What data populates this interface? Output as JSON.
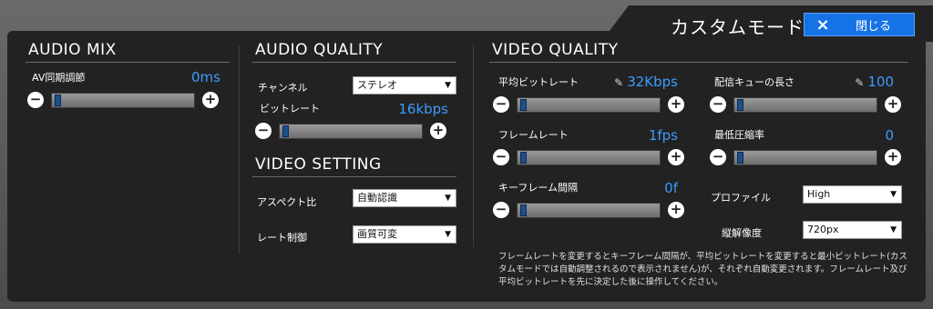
{
  "header": {
    "title": "カスタムモード",
    "close_label": "閉じる",
    "close_icon": "×"
  },
  "audio_mix": {
    "title": "AUDIO MIX",
    "av_sync": {
      "label": "AV同期調節",
      "value": "0ms",
      "level": 0.02
    }
  },
  "audio_quality": {
    "title": "AUDIO QUALITY",
    "channel": {
      "label": "チャンネル",
      "selected": "ステレオ"
    },
    "bitrate": {
      "label": "ビットレート",
      "value": "16kbps",
      "level": 0.02
    }
  },
  "video_setting": {
    "title": "VIDEO SETTING",
    "aspect": {
      "label": "アスペクト比",
      "selected": "自動認識"
    },
    "rate_control": {
      "label": "レート制御",
      "selected": "画質可変"
    }
  },
  "video_quality": {
    "title": "VIDEO QUALITY",
    "avg_bitrate": {
      "label": "平均ビットレート",
      "value": "32Kbps",
      "level": 0.02
    },
    "frame_rate": {
      "label": "フレームレート",
      "value": "1fps",
      "level": 0.02
    },
    "keyframe_interval": {
      "label": "キーフレーム間隔",
      "value": "0f",
      "level": 0.02
    },
    "queue_length": {
      "label": "配信キューの長さ",
      "value": "100",
      "level": 0.02
    },
    "min_compression": {
      "label": "最低圧縮率",
      "value": "0",
      "level": 0.02
    },
    "profile": {
      "label": "プロファイル",
      "selected": "High"
    },
    "vertical_resolution": {
      "label": "縦解像度",
      "selected": "720px"
    },
    "note": "フレームレートを変更するとキーフレーム間隔が、平均ビットレートを変更すると最小ビットレート(カスタムモードでは自動調整されるので表示されません)が、それぞれ自動変更されます。フレームレート及び平均ビットレートを先に決定した後に操作してください。"
  },
  "icons": {
    "minus": "−",
    "plus": "+",
    "dropdown": "▼",
    "pencil": "✎"
  },
  "colors": {
    "accent": "#1673e6",
    "value_text": "#3d9bff",
    "panel": "#222222"
  }
}
